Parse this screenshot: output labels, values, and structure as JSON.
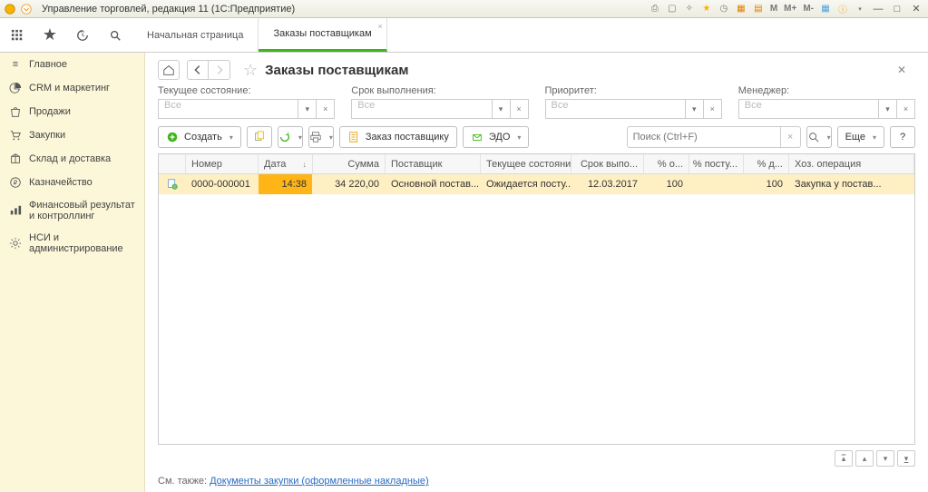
{
  "titlebar": {
    "title": "Управление торговлей, редакция 11  (1С:Предприятие)",
    "m_labels": [
      "M",
      "M+",
      "M-"
    ]
  },
  "tabs": [
    {
      "label": "Начальная страница",
      "active": false
    },
    {
      "label": "Заказы поставщикам",
      "active": true
    }
  ],
  "sidebar": {
    "items": [
      {
        "icon": "home",
        "label": "Главное"
      },
      {
        "icon": "pie",
        "label": "CRM и маркетинг"
      },
      {
        "icon": "bag",
        "label": "Продажи"
      },
      {
        "icon": "cart",
        "label": "Закупки"
      },
      {
        "icon": "box",
        "label": "Склад и доставка"
      },
      {
        "icon": "ruble",
        "label": "Казначейство"
      },
      {
        "icon": "bars",
        "label": "Финансовый результат и контроллинг"
      },
      {
        "icon": "gear",
        "label": "НСИ и администрирование"
      }
    ]
  },
  "page": {
    "title": "Заказы поставщикам"
  },
  "filters": {
    "state": {
      "label": "Текущее состояние:",
      "value": "Все"
    },
    "due": {
      "label": "Срок выполнения:",
      "value": "Все"
    },
    "priority": {
      "label": "Приоритет:",
      "value": "Все"
    },
    "manager": {
      "label": "Менеджер:",
      "value": "Все"
    }
  },
  "toolbar": {
    "create": "Создать",
    "order": "Заказ поставщику",
    "edo": "ЭДО",
    "more": "Еще"
  },
  "search": {
    "placeholder": "Поиск (Ctrl+F)"
  },
  "grid": {
    "headers": {
      "number": "Номер",
      "date": "Дата",
      "sum": "Сумма",
      "supplier": "Поставщик",
      "state": "Текущее состояние",
      "due": "Срок выпо...",
      "pay": "% о...",
      "receipt": "% посту...",
      "debt": "% д...",
      "op": "Хоз. операция"
    },
    "rows": [
      {
        "number": "0000-000001",
        "date": "14:38",
        "sum": "34 220,00",
        "supplier": "Основной постав...",
        "state": "Ожидается посту...",
        "due": "12.03.2017",
        "pay": "100",
        "receipt": "",
        "debt": "100",
        "op": "Закупка у постав..."
      }
    ]
  },
  "footer": {
    "prefix": "См. также: ",
    "link": "Документы закупки (оформленные накладные)"
  }
}
